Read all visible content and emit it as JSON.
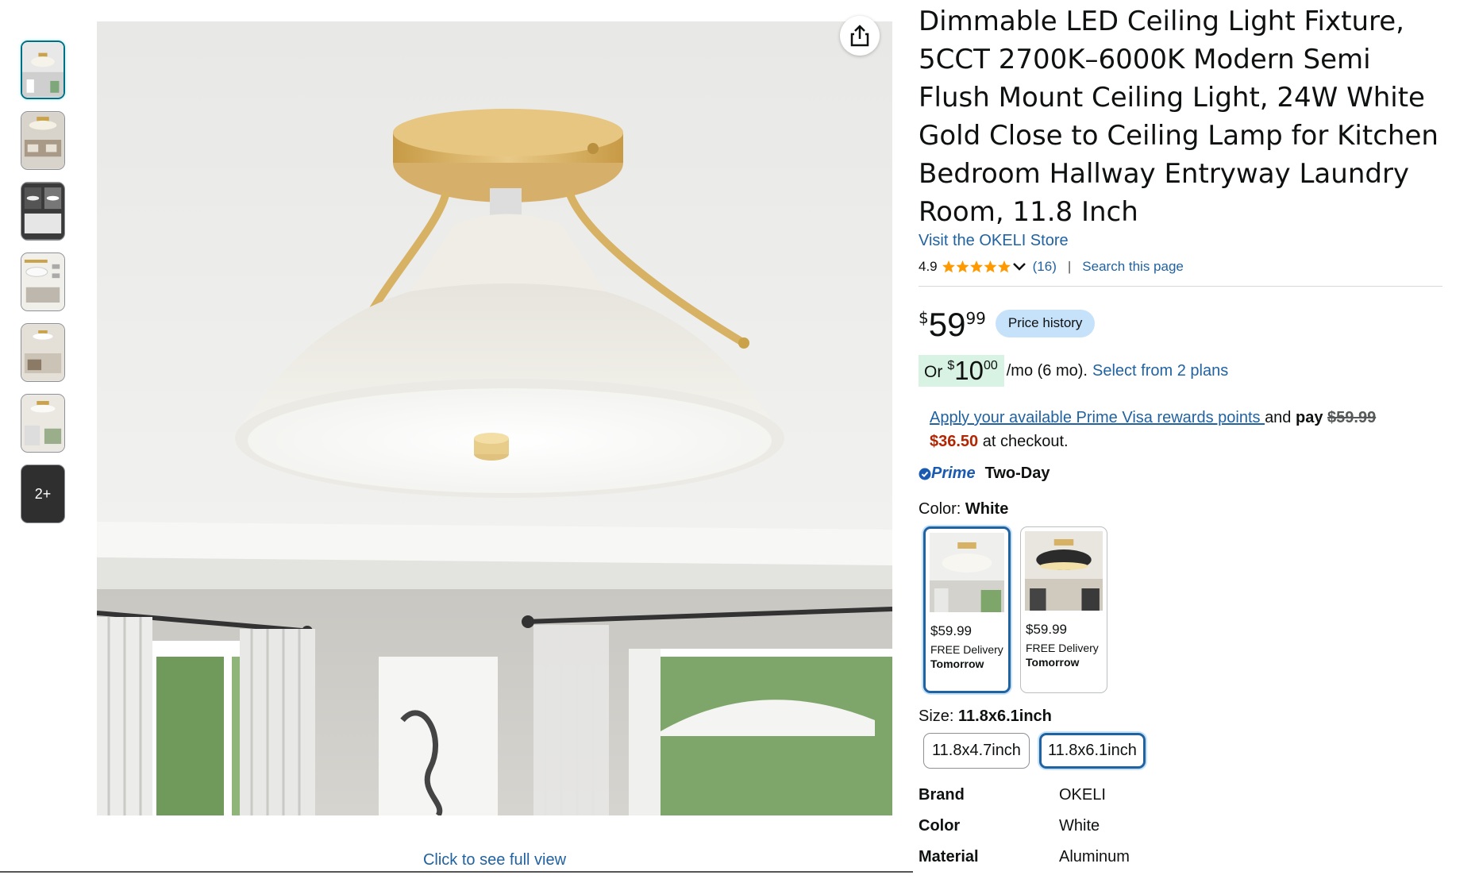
{
  "thumbnails": {
    "more_label": "2+"
  },
  "main_image": {
    "full_view_label": "Click to see full view"
  },
  "product": {
    "title": "Dimmable LED Ceiling Light Fixture, 5CCT 2700K–6000K Modern Semi Flush Mount Ceiling Light, 24W White Gold Close to Ceiling Lamp for Kitchen Bedroom Hallway Entryway Laundry Room, 11.8 Inch",
    "store_link": "Visit the OKELI Store",
    "rating": "4.9",
    "rating_stars": 5,
    "rating_count": "(16)",
    "separator": "|",
    "search_link": "Search this page"
  },
  "price": {
    "symbol": "$",
    "whole": "59",
    "fraction": "99",
    "history_label": "Price history"
  },
  "monthly": {
    "or": "Or",
    "symbol": "$",
    "whole": "10",
    "fraction": "00",
    "per_month": "/mo (6 mo).",
    "plans_link": "Select from 2 plans"
  },
  "visa": {
    "link": "Apply your available Prime Visa rewards points ",
    "and": "and ",
    "pay": "pay",
    "old_price": "$59.99",
    "new_price": "$36.50",
    "checkout": " at checkout."
  },
  "prime": {
    "logo": "Prime",
    "delivery": "Two-Day"
  },
  "color": {
    "label": "Color: ",
    "value": "White",
    "options": [
      {
        "price": "$59.99",
        "delivery": "FREE Delivery",
        "when": "Tomorrow"
      },
      {
        "price": "$59.99",
        "delivery": "FREE Delivery",
        "when": "Tomorrow"
      }
    ]
  },
  "size": {
    "label": "Size: ",
    "value": "11.8x6.1inch",
    "options": [
      "11.8x4.7inch",
      "11.8x6.1inch"
    ]
  },
  "specs": [
    {
      "key": "Brand",
      "value": "OKELI"
    },
    {
      "key": "Color",
      "value": "White"
    },
    {
      "key": "Material",
      "value": "Aluminum"
    }
  ],
  "colors": {
    "link": "#2162a1",
    "star": "#ff9900",
    "price_red": "#b12704",
    "prime_blue": "#1a5bb1",
    "selected_border": "#2162a1"
  }
}
